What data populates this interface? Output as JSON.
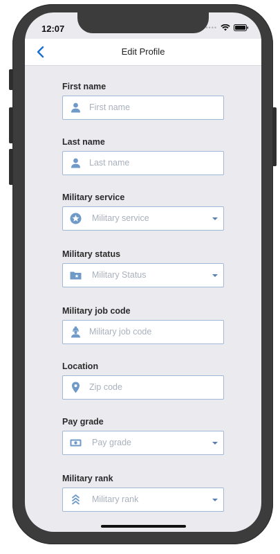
{
  "status_bar": {
    "time": "12:07"
  },
  "nav": {
    "title": "Edit Profile"
  },
  "fields": [
    {
      "label": "First name",
      "placeholder": "First name"
    },
    {
      "label": "Last name",
      "placeholder": "Last name"
    },
    {
      "label": "Military service",
      "placeholder": "Military service"
    },
    {
      "label": "Military status",
      "placeholder": "Military Status"
    },
    {
      "label": "Military job code",
      "placeholder": "Military job code"
    },
    {
      "label": "Location",
      "placeholder": "Zip code"
    },
    {
      "label": "Pay grade",
      "placeholder": "Pay grade"
    },
    {
      "label": "Military rank",
      "placeholder": "Military rank"
    }
  ],
  "colors": {
    "accent": "#6f9ac8",
    "border": "#9fb8d6",
    "background": "#eaeaef",
    "nav_accent": "#1a6fd1"
  },
  "icons": [
    "person-icon",
    "person-icon",
    "star-badge-icon",
    "star-folder-icon",
    "worker-icon",
    "location-pin-icon",
    "cash-icon",
    "chevron-rank-icon"
  ]
}
